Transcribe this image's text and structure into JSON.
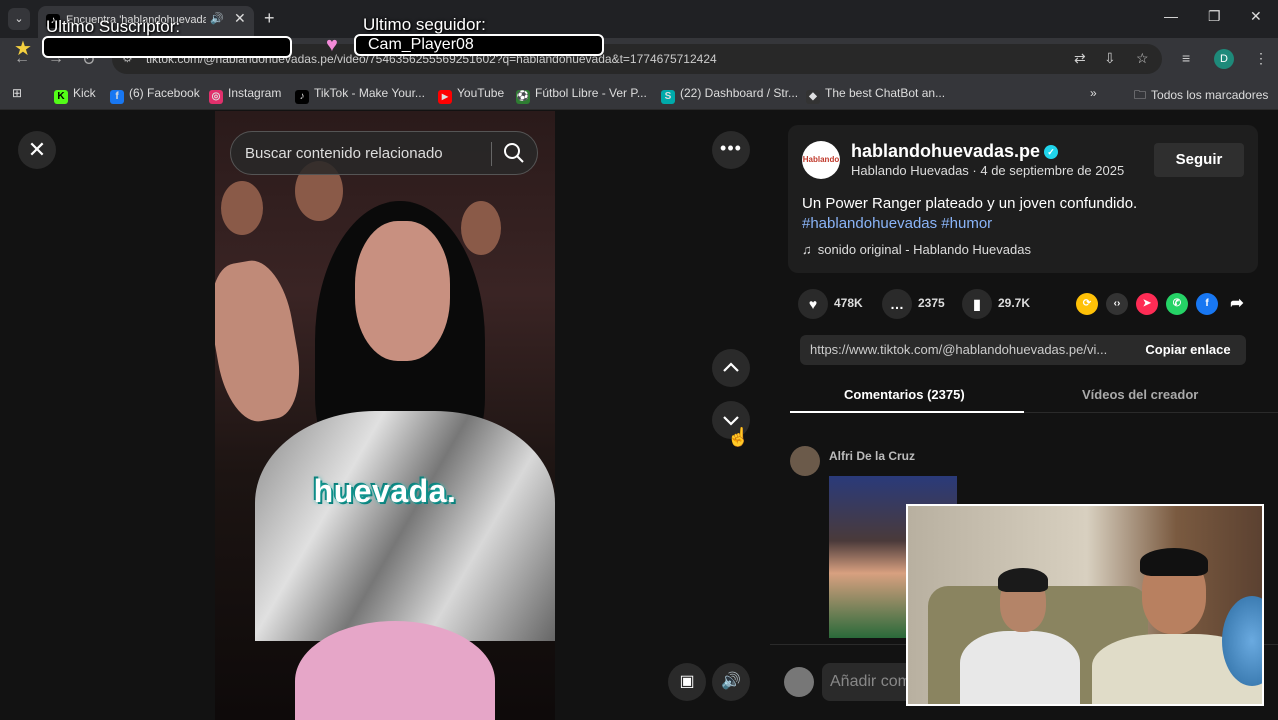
{
  "browser": {
    "tab_title": "Encuentra 'hablandohuevada",
    "url": "tiktok.com/@hablandohuevadas.pe/video/7546356255569251602?q=hablandohuevada&t=1774675712424",
    "profile_initial": "D"
  },
  "bookmarks": [
    {
      "label": "Kick",
      "icon_color": "#53fc18",
      "icon_char": "K"
    },
    {
      "label": "(6) Facebook",
      "icon_color": "#1877f2",
      "icon_char": "f"
    },
    {
      "label": "Instagram",
      "icon_color": "#e1306c",
      "icon_char": "◎"
    },
    {
      "label": "TikTok - Make Your...",
      "icon_color": "#000000",
      "icon_char": "♪"
    },
    {
      "label": "YouTube",
      "icon_color": "#ff0000",
      "icon_char": "▶"
    },
    {
      "label": "Fútbol Libre - Ver P...",
      "icon_color": "#2e7d32",
      "icon_char": "⚽"
    },
    {
      "label": "(22) Dashboard / Str...",
      "icon_color": "#0aa",
      "icon_char": "S"
    },
    {
      "label": "The best ChatBot an...",
      "icon_color": "#333333",
      "icon_char": "◆"
    }
  ],
  "bookmarks_folder": "Todos los marcadores",
  "overlay": {
    "subscriber_label": "Ultimo Suscriptor:",
    "follower_label": "Ultimo seguidor:",
    "follower_value": "Cam_Player08"
  },
  "video": {
    "search_placeholder": "Buscar contenido relacionado",
    "caption": "huevada."
  },
  "post": {
    "author": "hablandohuevadas.pe",
    "author_sub": "Hablando Huevadas · 4 de septiembre de 2025",
    "follow_label": "Seguir",
    "description": "Un Power Ranger plateado y un joven confundido.",
    "tags": "#hablandohuevadas #humor",
    "music": "sonido original - Hablando Huevadas",
    "likes": "478K",
    "comments": "2375",
    "saves": "29.7K",
    "link": "https://www.tiktok.com/@hablandohuevadas.pe/vi...",
    "copy_label": "Copiar enlace"
  },
  "tabs": {
    "comments": "Comentarios (2375)",
    "creator_videos": "Vídeos del creador"
  },
  "comment": {
    "author": "Alfri De la Cruz"
  },
  "add_comment_placeholder": "Añadir com"
}
